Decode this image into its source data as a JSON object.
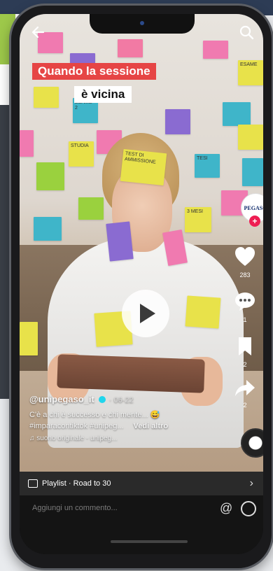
{
  "video": {
    "caption_line1": "Quando la sessione",
    "caption_line2": "è vicina",
    "notes": [
      {
        "text": "TEST DI AMMISSIONE"
      },
      {
        "text": "ESAME 2"
      },
      {
        "text": "STUDIA"
      },
      {
        "text": "ESAME"
      },
      {
        "text": "TESI"
      },
      {
        "text": "3 MESI"
      }
    ]
  },
  "actions": {
    "likes": "283",
    "comments": "1",
    "saves": "2",
    "shares": "2",
    "profile_name": "PEGASO"
  },
  "post": {
    "username": "@unipegaso_it",
    "date": "06-22",
    "description": "C'è a chi è successo e chi mente...",
    "hashtags": "#imparacontiktok #unipeg...",
    "see_more": "Vedi altro",
    "music": "suono originale - unipeg..."
  },
  "playlist": {
    "label": "Playlist · Road to 30"
  },
  "comment": {
    "placeholder": "Aggiungi un commento..."
  },
  "colors": {
    "accent": "#ee1d52",
    "caption_red": "#e64545"
  }
}
